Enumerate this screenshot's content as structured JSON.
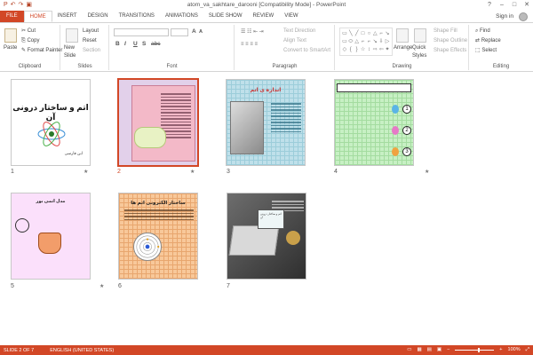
{
  "window": {
    "title": "atom_va_sakhtare_darooni [Compatibility Mode] - PowerPoint",
    "controls": [
      "?",
      "–",
      "□",
      "✕"
    ]
  },
  "qat": [
    "P",
    "↶",
    "↷",
    "▣"
  ],
  "tabs": [
    "FILE",
    "HOME",
    "INSERT",
    "DESIGN",
    "TRANSITIONS",
    "ANIMATIONS",
    "SLIDE SHOW",
    "REVIEW",
    "VIEW"
  ],
  "active_tab": "HOME",
  "account": {
    "label": "Sign in"
  },
  "ribbon": {
    "clipboard": {
      "label": "Clipboard",
      "paste": "Paste",
      "cut": "Cut",
      "copy": "Copy",
      "format_painter": "Format Painter"
    },
    "slides": {
      "label": "Slides",
      "new_slide": "New Slide",
      "layout": "Layout",
      "reset": "Reset",
      "section": "Section"
    },
    "font": {
      "label": "Font",
      "bold": "B",
      "italic": "I",
      "underline": "U",
      "shadow": "S",
      "strike": "abc",
      "size_up": "A",
      "size_down": "A"
    },
    "paragraph": {
      "label": "Paragraph",
      "text_direction": "Text Direction",
      "align_text": "Align Text",
      "convert_smartart": "Convert to SmartArt"
    },
    "drawing": {
      "label": "Drawing",
      "arrange": "Arrange",
      "quick_styles": "Quick Styles",
      "shape_fill": "Shape Fill",
      "shape_outline": "Shape Outline",
      "shape_effects": "Shape Effects"
    },
    "editing": {
      "label": "Editing",
      "find": "Find",
      "replace": "Replace",
      "select": "Select"
    }
  },
  "shapes_glyphs": [
    "▭",
    "╲",
    "╱",
    "□",
    "○",
    "△",
    "⌐",
    "↘",
    "▭",
    "⬭",
    "△",
    "⌐",
    "⌐",
    "↘",
    "⇩",
    "▷",
    "◇",
    "{",
    "}",
    "☆",
    "↕",
    "⇨",
    "⇦",
    "✦"
  ],
  "slides": [
    {
      "num": "1",
      "star": "★",
      "title": "اتم و ساختار درونی آن",
      "author": "ابن فارسی",
      "selected": false
    },
    {
      "num": "2",
      "star": "★",
      "selected": true
    },
    {
      "num": "3",
      "star": "",
      "title": "اندازه ی اتم",
      "selected": false
    },
    {
      "num": "4",
      "star": "★",
      "selected": false,
      "circles": [
        "1",
        "2",
        "3"
      ]
    },
    {
      "num": "5",
      "star": "★",
      "title": "مدل اتمی بور",
      "selected": false
    },
    {
      "num": "6",
      "star": "",
      "title": "ساختار الکترونی اتم ها",
      "selected": false
    },
    {
      "num": "7",
      "star": "",
      "screen_text": "اتم و ساختار درونی آن",
      "selected": false
    }
  ],
  "status": {
    "slide": "SLIDE 2 OF 7",
    "language": "ENGLISH (UNITED STATES)",
    "zoom": "100%",
    "zoom_minus": "−",
    "zoom_plus": "+"
  },
  "colors": {
    "accent": "#d24726",
    "ribbon_border": "#d4d4d4"
  }
}
